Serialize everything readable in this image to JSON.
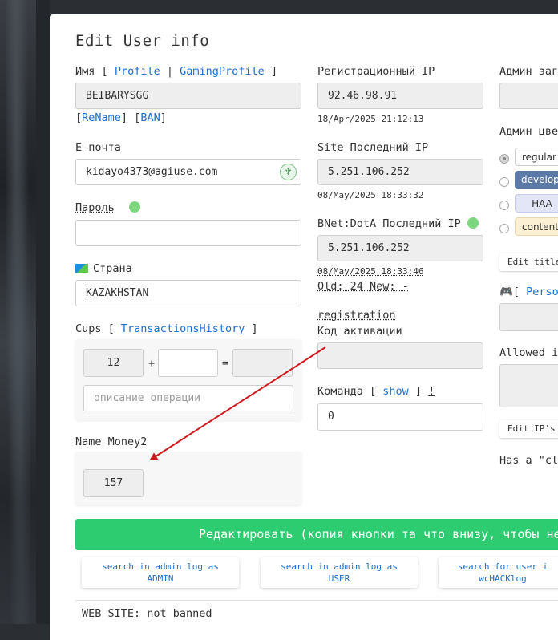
{
  "page": {
    "title": "Edit User info"
  },
  "name_section": {
    "label": "Имя",
    "bracket_open": "[",
    "profile_link": "Profile",
    "pipe": "|",
    "gaming_link": "GamingProfile",
    "bracket_close": "]",
    "value": "BEIBARYSGG",
    "rename_link": "ReName",
    "ban_link": "BAN"
  },
  "email": {
    "label": "E-почта",
    "value": "kidayo4373@agiuse.com"
  },
  "password": {
    "label": "Пароль",
    "value": ""
  },
  "country": {
    "label": "Страна",
    "value": "KAZAKHSTAN"
  },
  "cups": {
    "label": "Cups [",
    "transactions_link": "TransactionsHistory",
    "bracket_close": "]",
    "current": "12",
    "plus": "+",
    "add_value": "",
    "equals": "=",
    "result": "",
    "description_placeholder": "описание операции"
  },
  "money": {
    "label": "Name Money2",
    "value": "157"
  },
  "reg_ip": {
    "label": "Регистрационный IP",
    "value": "92.46.98.91",
    "date": "18/Apr/2025 21:12:13"
  },
  "site_ip": {
    "label": "Site Последний IP",
    "value": "5.251.106.252",
    "date": "08/May/2025 18:33:32"
  },
  "bnet_ip": {
    "label": "BNet:DotA Последний IP",
    "value": "5.251.106.252",
    "date": "08/May/2025 18:33:46",
    "old_new": "Old: 24 New: -"
  },
  "registration": {
    "link": "registration",
    "activation_label": "Код активации",
    "activation_value": ""
  },
  "team": {
    "label": "Команда [",
    "show_link": "show",
    "bracket_close": "]",
    "bang": "!",
    "value": "0"
  },
  "admin": {
    "title_label": "Админ заго",
    "color_label": "Админ цвет",
    "colors": [
      {
        "label": "regular",
        "bg": "#ffffff",
        "fg": "#333333",
        "selected": true
      },
      {
        "label": "developer",
        "bg": "#5b7aa8",
        "fg": "#ffffff",
        "selected": false
      },
      {
        "label": "HAA",
        "bg": "#e3e6f7",
        "fg": "#333333",
        "selected": false
      },
      {
        "label": "contentm",
        "bg": "#fbf0d4",
        "fg": "#333333",
        "selected": false
      }
    ],
    "edit_title_button": "Edit title",
    "personal_open": "[",
    "personal_link": "Perso",
    "allowed_ip_label": "Allowed ip",
    "edit_ips_button": "Edit IP's",
    "has_a": "Has a \"clo"
  },
  "actions": {
    "submit_label": "Редактировать (копия кнопки та что внизу, чтобы не",
    "search_admin_line1": "search in admin log as",
    "search_admin_line2": "ADMIN",
    "search_user_line1": "search in admin log as",
    "search_user_line2": "USER",
    "search_wc_line1": "search for user i",
    "search_wc_line2": "wcHACKlog"
  },
  "website": {
    "status": "WEB SITE: not banned"
  },
  "colors": {
    "accent_link": "#1a6fd1",
    "submit_green": "#2ecc71",
    "status_dot": "#7ed67e",
    "arrow": "#d0191e"
  }
}
